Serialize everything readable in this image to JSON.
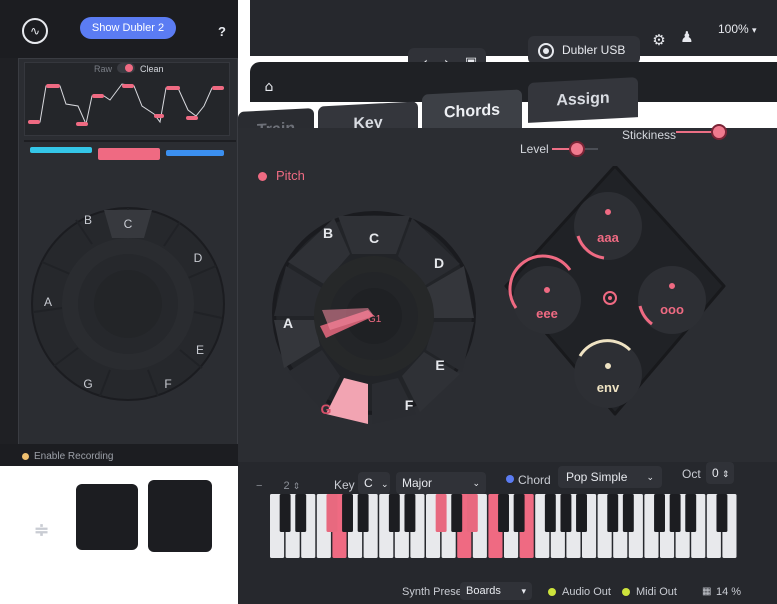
{
  "overlay": {
    "show_button": "Show Dubler 2",
    "help": "?",
    "raw": "Raw",
    "clean": "Clean",
    "wheel_notes": [
      "C",
      "D",
      "E",
      "F",
      "G",
      "A",
      "B"
    ],
    "enable_recording": "Enable Recording",
    "bars": [
      "#34c6e8",
      "#ef6a82",
      "#3b8ff0"
    ]
  },
  "toolbar": {
    "prev": "‹",
    "next": "›",
    "device": "Dubler USB",
    "zoom": "100%"
  },
  "tabs": [
    "Train",
    "Key",
    "Chords",
    "Assign"
  ],
  "panel": {
    "pitch": "Pitch",
    "level": "Level",
    "level_value": 0.55,
    "stickiness": "Stickiness",
    "stickiness_value": 0.9,
    "center_note": "G1",
    "wheel_notes": [
      "C",
      "D",
      "E",
      "F",
      "G",
      "A",
      "B"
    ],
    "pads": [
      "aaa",
      "eee",
      "ooo",
      "env"
    ]
  },
  "keys": {
    "transpose": "2",
    "key_label": "Key",
    "key_value": "C",
    "scale_value": "Major",
    "chord_label": "Chord",
    "chord_value": "Pop Simple",
    "oct_label": "Oct",
    "oct_value": "0"
  },
  "footer": {
    "synth_preset_label": "Synth Preset",
    "synth_preset_value": "Boards",
    "audio_out": "Audio Out",
    "midi_out": "Midi Out",
    "cpu": "14 %"
  },
  "colors": {
    "accent": "#ef6a82",
    "bg": "#2b2d32",
    "env": "#efe3c3"
  }
}
